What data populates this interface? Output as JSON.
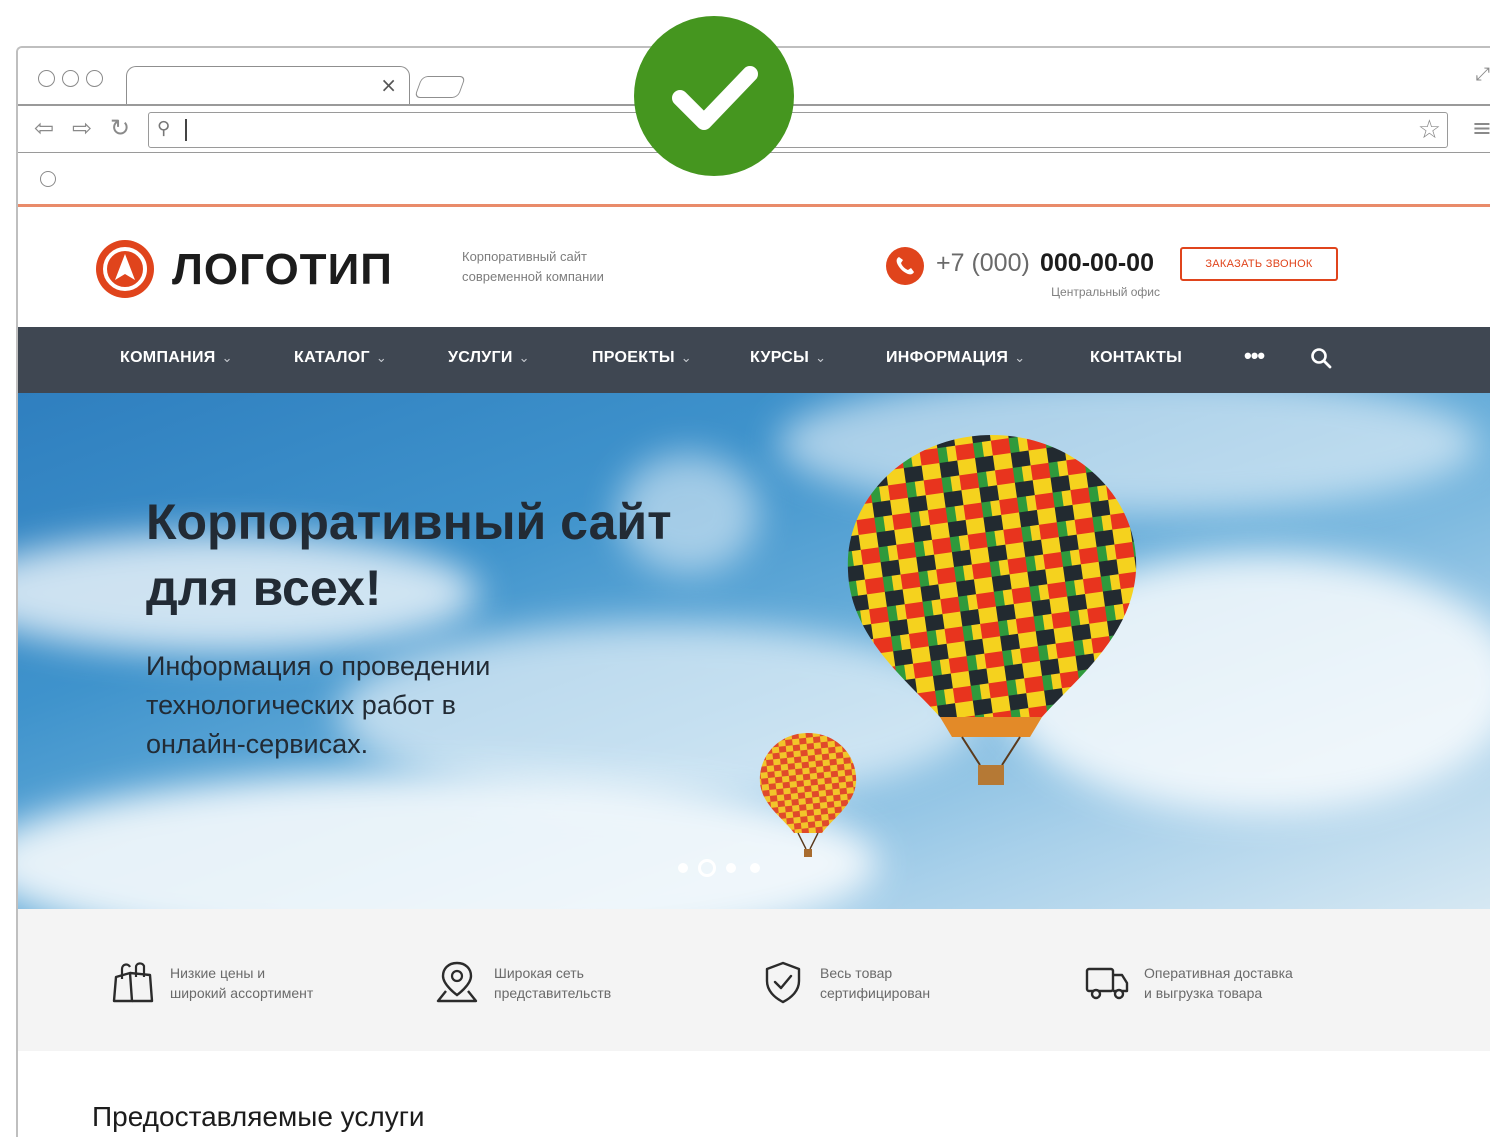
{
  "browser": {
    "tab_close": "×",
    "expand_icon": "⤢",
    "nav": {
      "back": "⇦",
      "forward": "⇨",
      "reload": "↻"
    },
    "search_glyph": "⚲",
    "star_icon": "☆",
    "menu_icon": "≡"
  },
  "site": {
    "logo_text": "ЛОГОТИП",
    "tagline": [
      "Корпоративный сайт",
      "современной компании"
    ],
    "phone_prefix": "+7 (000)",
    "phone_main": "000-00-00",
    "phone_sub": "Центральный офис",
    "callback_label": "ЗАКАЗАТЬ ЗВОНОК",
    "accent_color": "#e0441c",
    "nav_bg": "#3f4752",
    "nav": [
      {
        "label": "КОМПАНИЯ",
        "chevron": "⌄"
      },
      {
        "label": "КАТАЛОГ",
        "chevron": "⌄"
      },
      {
        "label": "УСЛУГИ",
        "chevron": "⌄"
      },
      {
        "label": "ПРОЕКТЫ",
        "chevron": "⌄"
      },
      {
        "label": "КУРСЫ",
        "chevron": "⌄"
      },
      {
        "label": "ИНФОРМАЦИЯ",
        "chevron": "⌄"
      },
      {
        "label": "КОНТАКТЫ",
        "chevron": ""
      }
    ],
    "nav_more": "•••",
    "hero": {
      "title_line1": "Корпоративный сайт",
      "title_line2": "для всех!",
      "text_line1": "Информация о проведении",
      "text_line2": "технологических работ в",
      "text_line3": "онлайн-сервисах.",
      "slide_count": 4,
      "active_slide": 2
    },
    "features": [
      {
        "icon": "shopping-bag-icon",
        "line1": "Низкие цены и",
        "line2": "широкий ассортимент"
      },
      {
        "icon": "map-pin-icon",
        "line1": "Широкая сеть",
        "line2": "представительств"
      },
      {
        "icon": "shield-check-icon",
        "line1": "Весь товар",
        "line2": "сертифицирован"
      },
      {
        "icon": "truck-icon",
        "line1": "Оперативная доставка",
        "line2": "и выгрузка товара"
      }
    ],
    "services_title": "Предоставляемые услуги"
  },
  "badge": {
    "icon": "checkmark-icon",
    "color": "#45961f"
  }
}
